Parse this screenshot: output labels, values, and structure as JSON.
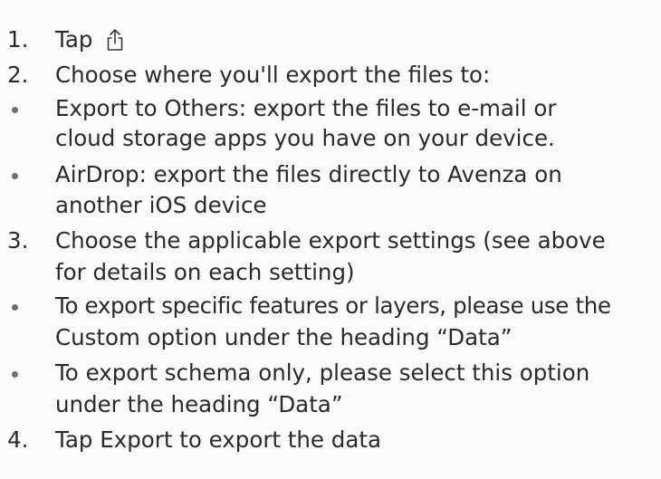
{
  "items": [
    {
      "marker": "1.",
      "text": "Tap",
      "icon": "share-icon"
    },
    {
      "marker": "2.",
      "text": "Choose where you'll export the files to:"
    },
    {
      "marker": "•",
      "text": "Export to Others: export the files to e-mail or",
      "continuation": "cloud storage apps you have on your device."
    },
    {
      "marker": "•",
      "text": "AirDrop: export the files directly to Avenza on",
      "continuation": "another iOS device"
    },
    {
      "marker": "3.",
      "text": "Choose the applicable export settings (see above",
      "continuation": "for details on each setting)"
    },
    {
      "marker": "•",
      "text": "To export specific features or layers, please use the",
      "continuation": "Custom option under the heading “Data”"
    },
    {
      "marker": "•",
      "text": "To export schema only, please select this option",
      "continuation": "under the heading “Data”"
    },
    {
      "marker": "4.",
      "text": "Tap Export to export the data"
    }
  ]
}
